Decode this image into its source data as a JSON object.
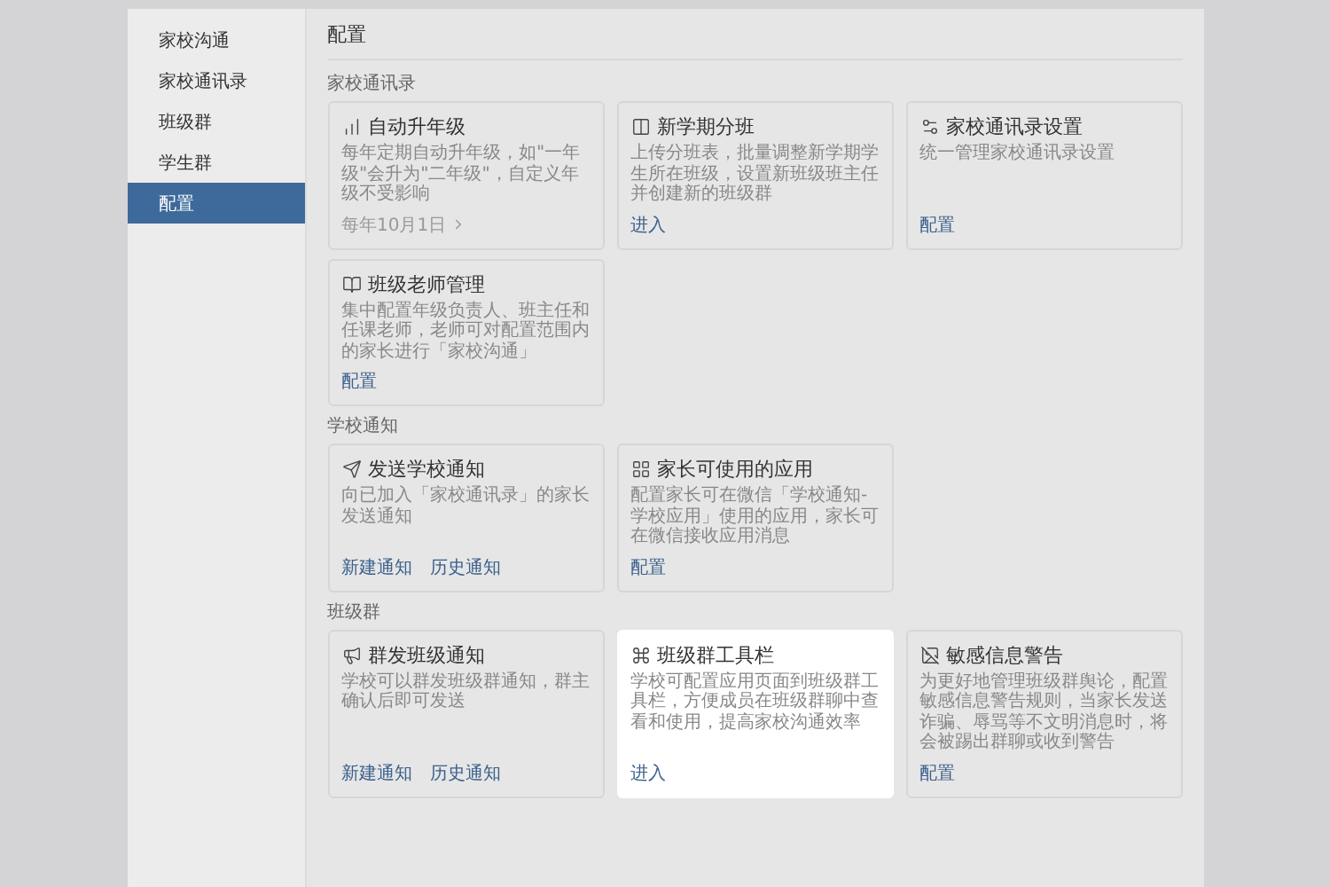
{
  "sidebar": {
    "items": [
      {
        "label": "家校沟通",
        "selected": false
      },
      {
        "label": "家校通讯录",
        "selected": false
      },
      {
        "label": "班级群",
        "selected": false
      },
      {
        "label": "学生群",
        "selected": false
      },
      {
        "label": "配置",
        "selected": true
      }
    ]
  },
  "page_title": "配置",
  "sections": [
    {
      "label": "家校通讯录",
      "cards": [
        {
          "title": "自动升年级",
          "description": "每年定期自动升年级，如\"一年级\"会升为\"二年级\"，自定义年级不受影响",
          "highlighted": false,
          "links": [
            {
              "label": "每年10月1日",
              "kind": "date"
            }
          ]
        },
        {
          "title": "新学期分班",
          "description": "上传分班表，批量调整新学期学生所在班级，设置新班级班主任并创建新的班级群",
          "highlighted": false,
          "links": [
            {
              "label": "进入",
              "kind": "action"
            }
          ]
        },
        {
          "title": "家校通讯录设置",
          "description": "统一管理家校通讯录设置",
          "highlighted": false,
          "links": [
            {
              "label": "配置",
              "kind": "action"
            }
          ]
        },
        {
          "title": "班级老师管理",
          "description": "集中配置年级负责人、班主任和任课老师，老师可对配置范围内的家长进行「家校沟通」",
          "highlighted": false,
          "links": [
            {
              "label": "配置",
              "kind": "action"
            }
          ]
        }
      ]
    },
    {
      "label": "学校通知",
      "cards": [
        {
          "title": "发送学校通知",
          "description": "向已加入「家校通讯录」的家长发送通知",
          "highlighted": false,
          "links": [
            {
              "label": "新建通知",
              "kind": "action"
            },
            {
              "label": "历史通知",
              "kind": "action"
            }
          ]
        },
        {
          "title": "家长可使用的应用",
          "description": "配置家长可在微信「学校通知-学校应用」使用的应用，家长可在微信接收应用消息",
          "highlighted": false,
          "links": [
            {
              "label": "配置",
              "kind": "action"
            }
          ]
        }
      ]
    },
    {
      "label": "班级群",
      "cards": [
        {
          "title": "群发班级通知",
          "description": "学校可以群发班级群通知，群主确认后即可发送",
          "highlighted": false,
          "links": [
            {
              "label": "新建通知",
              "kind": "action"
            },
            {
              "label": "历史通知",
              "kind": "action"
            }
          ]
        },
        {
          "title": "班级群工具栏",
          "description": "学校可配置应用页面到班级群工具栏，方便成员在班级群聊中查看和使用，提高家校沟通效率",
          "highlighted": true,
          "links": [
            {
              "label": "进入",
              "kind": "action"
            }
          ]
        },
        {
          "title": "敏感信息警告",
          "description": "为更好地管理班级群舆论，配置敏感信息警告规则，当家长发送诈骗、辱骂等不文明消息时，将会被踢出群聊或收到警告",
          "highlighted": false,
          "links": [
            {
              "label": "配置",
              "kind": "action"
            }
          ]
        }
      ]
    }
  ]
}
